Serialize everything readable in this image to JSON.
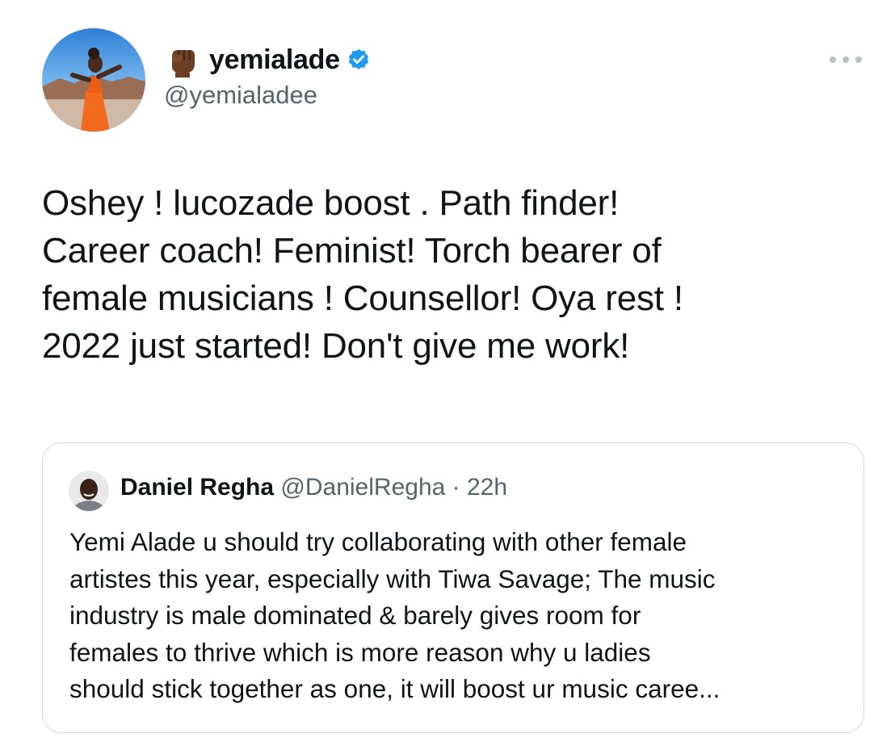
{
  "tweet": {
    "display_name": "yemialade",
    "handle": "@yemialadee",
    "text": "Oshey ! lucozade boost . Path finder!\nCareer  coach! Feminist! Torch bearer of\nfemale musicians ! Counsellor! Oya rest !\n2022 just  started! Don't give me work!"
  },
  "quote": {
    "display_name": "Daniel Regha",
    "handle": "@DanielRegha",
    "separator": " · ",
    "time": "22h",
    "text": "Yemi Alade u should try collaborating with other female\nartistes this year, especially with Tiwa Savage; The music\nindustry is male dominated & barely gives room for\nfemales to thrive which is more reason why u ladies\nshould stick together as one, it will boost ur music caree..."
  },
  "icons": {
    "name_emoji": "raised-fist-emoji",
    "verified": "verified-badge-icon",
    "more": "more-options-icon",
    "verified_color": "#1d9bf0"
  }
}
